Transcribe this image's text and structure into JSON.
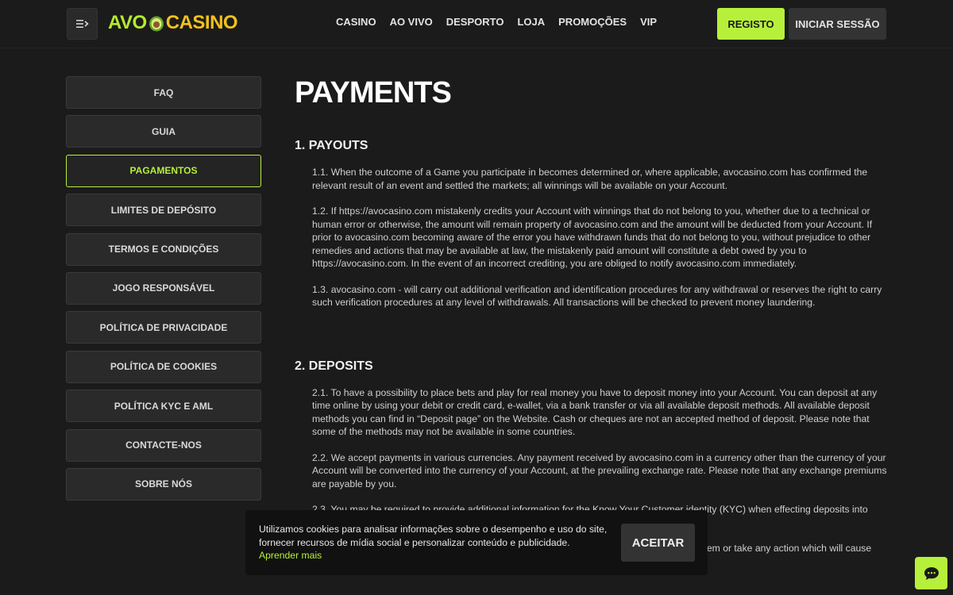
{
  "header": {
    "logo_left": "AVO",
    "logo_right": "CASINO",
    "nav": [
      "CASINO",
      "AO VIVO",
      "DESPORTO",
      "LOJA",
      "PROMOÇÕES",
      "VIP"
    ],
    "register_label": "REGISTO",
    "login_label": "INICIAR SESSÃO"
  },
  "sidebar": {
    "items": [
      {
        "label": "FAQ"
      },
      {
        "label": "GUIA"
      },
      {
        "label": "PAGAMENTOS",
        "active": true
      },
      {
        "label": "LIMITES DE DEPÓSITO"
      },
      {
        "label": "TERMOS E CONDIÇÕES"
      },
      {
        "label": "JOGO RESPONSÁVEL"
      },
      {
        "label": "POLÍTICA DE PRIVACIDADE"
      },
      {
        "label": "POLÍTICA DE COOKIES"
      },
      {
        "label": "POLÍTICA KYC E AML"
      },
      {
        "label": "CONTACTE-NOS"
      },
      {
        "label": "SOBRE NÓS"
      }
    ]
  },
  "content": {
    "title": "PAYMENTS",
    "sections": [
      {
        "heading": "1. PAYOUTS",
        "paragraphs": [
          "1.1. When the outcome of a Game you participate in becomes determined or, where applicable, avocasino.com has confirmed the relevant result of an event and settled the markets; all winnings will be available on your Account.",
          "1.2. If https://avocasino.com mistakenly credits your Account with winnings that do not belong to you, whether due to a technical or human error or otherwise, the amount will remain property of avocasino.com and the amount will be deducted from your Account. If prior to avocasino.com becoming aware of the error you have withdrawn funds that do not belong to you, without prejudice to other remedies and actions that may be available at law, the mistakenly paid amount will constitute a debt owed by you to https://avocasino.com. In the event of an incorrect crediting, you are obliged to notify avocasino.com immediately.",
          "1.3. avocasino.com - will carry out additional verification and identification procedures for any withdrawal or reserves the right to carry such verification procedures at any level of withdrawals. All transactions will be checked to prevent money laundering."
        ]
      },
      {
        "heading": "2. DEPOSITS",
        "paragraphs": [
          "2.1. To have a possibility to place bets and play for real money you have to deposit money into your Account. You can deposit at any time online by using your debit or credit card, e-wallet, via a bank transfer or via all available deposit methods. All available deposit methods you can find in “Deposit page” on the Website. Cash or cheques are not an accepted method of deposit. Please note that some of the methods may not be available in some countries.",
          "2.2. We accept payments in various currencies. Any payment received by avocasino.com in a currency other than the currency of your Account will be converted into the currency of your Account, at the prevailing exchange rate. Please note that any exchange premiums are payable by you.",
          "2.3. You may be required to provide additional information for the Know Your Customer identity (KYC) when effecting deposits into your Account.",
          "2.5. By depositing you confirm that all deposits are authorized and you won't try to decline them or take any action which will cause such payments to be reversed by the third party, in order to avoid any legitimate liability."
        ]
      }
    ]
  },
  "cookie": {
    "text": "Utilizamos cookies para analisar informações sobre o desempenho e uso do site, fornecer recursos de mídia social e personalizar conteúdo e publicidade.",
    "link": "Aprender mais",
    "accept_label": "ACEITAR"
  },
  "colors": {
    "accent": "#b7f03b",
    "logo_yellow": "#f2c21b",
    "background": "#1b1b1b",
    "panel": "#2a2a2a"
  },
  "icons": {
    "menu": "menu-collapse-icon",
    "chat": "chat-support-icon",
    "logo": "avocado-icon"
  }
}
